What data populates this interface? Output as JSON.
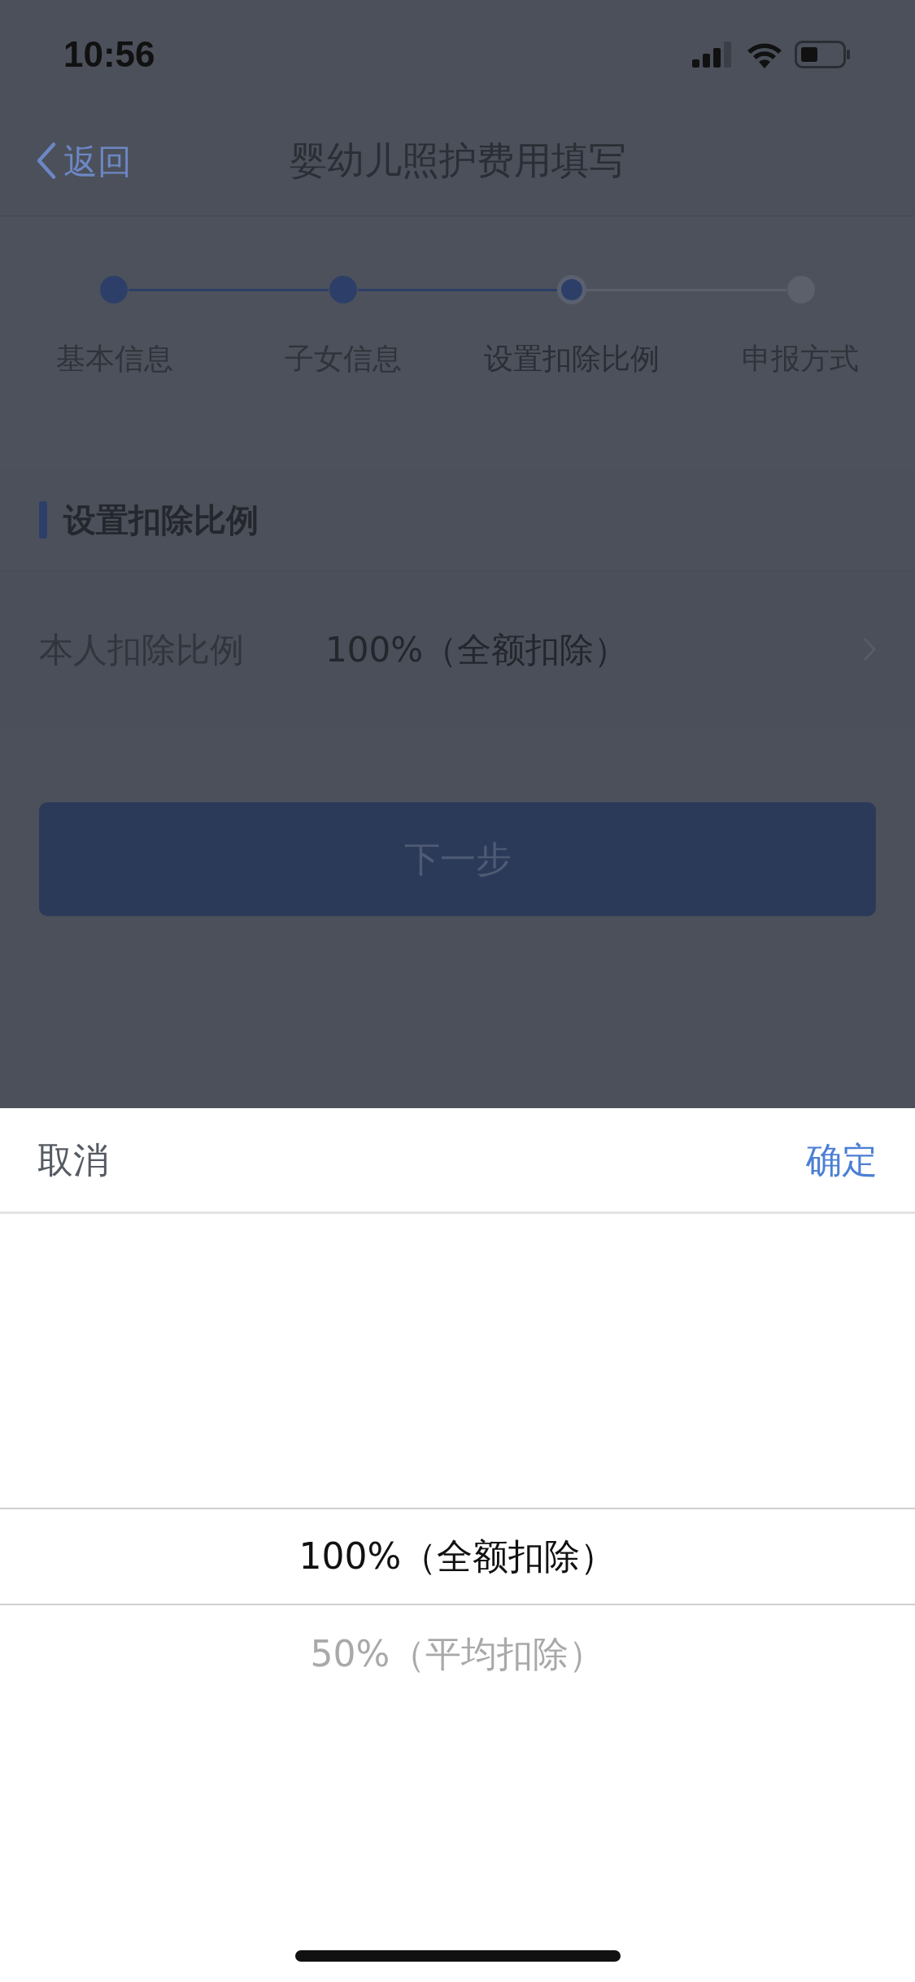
{
  "status_bar": {
    "time": "10:56"
  },
  "nav": {
    "back": "返回",
    "title": "婴幼儿照护费用填写"
  },
  "steps": [
    {
      "label": "基本信息",
      "completed": true,
      "selected": false
    },
    {
      "label": "子女信息",
      "completed": true,
      "selected": false
    },
    {
      "label": "设置扣除比例",
      "completed": true,
      "selected": true
    },
    {
      "label": "申报方式",
      "completed": false,
      "selected": false
    }
  ],
  "section": {
    "title": "设置扣除比例"
  },
  "field": {
    "label": "本人扣除比例",
    "value": "100%（全额扣除）"
  },
  "next_button": {
    "label": "下一步",
    "disabled": true
  },
  "picker": {
    "cancel": "取消",
    "confirm": "确定",
    "options": [
      {
        "label": "100%（全额扣除）",
        "selected": true
      },
      {
        "label": "50%（平均扣除）",
        "selected": false
      }
    ]
  }
}
